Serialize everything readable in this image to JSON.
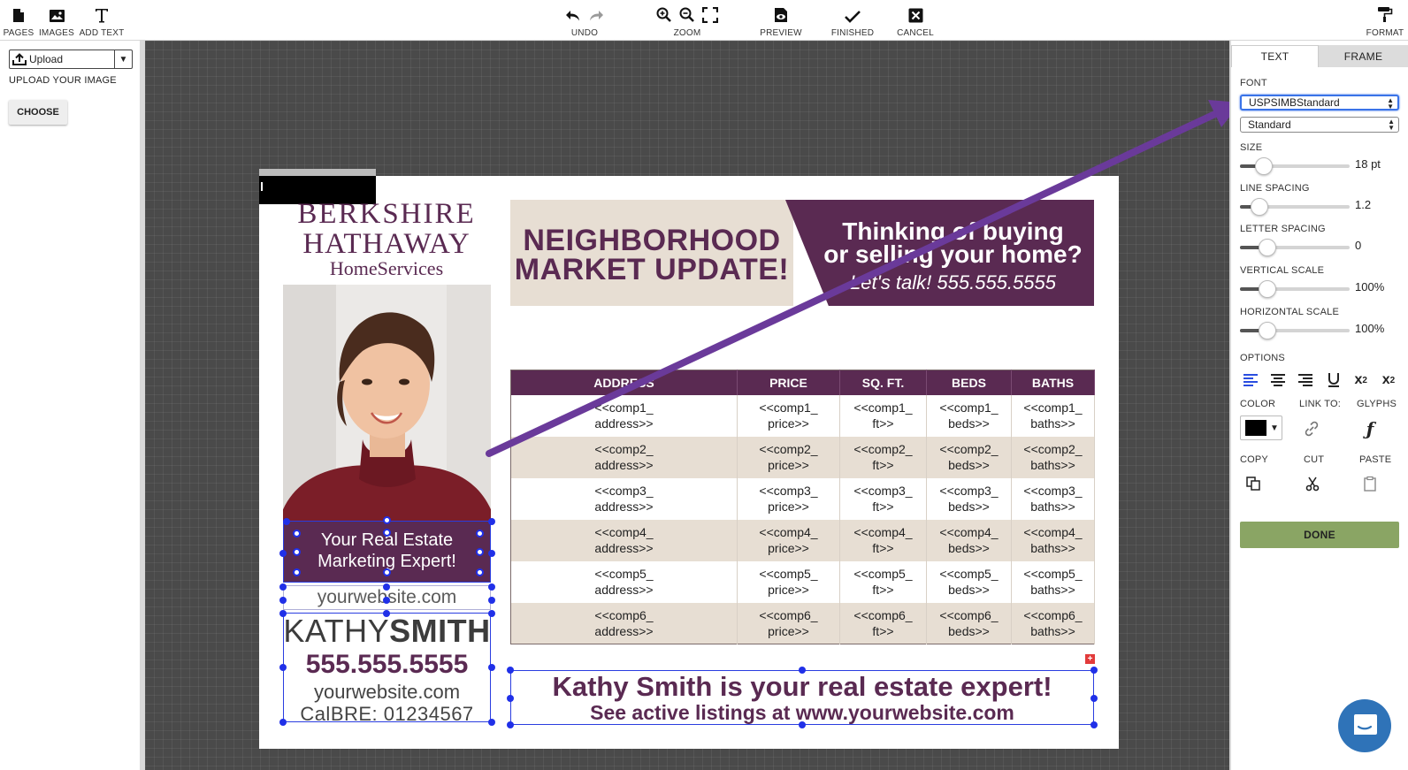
{
  "toolbar": {
    "pages": "PAGES",
    "images": "IMAGES",
    "add_text": "ADD TEXT",
    "undo": "UNDO",
    "zoom": "ZOOM",
    "preview": "PREVIEW",
    "finished": "FINISHED",
    "cancel": "CANCEL",
    "format": "FORMAT"
  },
  "left_panel": {
    "upload_select": "Upload",
    "upload_caption": "UPLOAD YOUR IMAGE",
    "choose_button": "CHOOSE"
  },
  "document": {
    "logo": [
      "BERKSHIRE",
      "HATHAWAY",
      "HomeServices"
    ],
    "banner_title_1": "NEIGHBORHOOD",
    "banner_title_2": "MARKET UPDATE!",
    "banner_right_1": "Thinking of buying",
    "banner_right_2": "or selling your home?",
    "banner_right_3": "Let's talk! 555.555.5555",
    "tagline_1": "Your Real Estate",
    "tagline_2": "Marketing Expert!",
    "website_small": "yourwebsite.com",
    "name_first": "KATHY",
    "name_last": "SMITH",
    "phone": "555.555.5555",
    "website": "yourwebsite.com",
    "calbre": "CalBRE: 01234567",
    "cta_1": "Kathy Smith is your real estate expert!",
    "cta_2": "See active listings at www.yourwebsite.com",
    "table": {
      "headers": [
        "ADDRESS",
        "PRICE",
        "SQ. FT.",
        "BEDS",
        "BATHS"
      ],
      "rows": [
        [
          [
            "<<comp1_",
            "address>>"
          ],
          [
            "<<comp1_",
            "price>>"
          ],
          [
            "<<comp1_",
            "ft>>"
          ],
          [
            "<<comp1_",
            "beds>>"
          ],
          [
            "<<comp1_",
            "baths>>"
          ]
        ],
        [
          [
            "<<comp2_",
            "address>>"
          ],
          [
            "<<comp2_",
            "price>>"
          ],
          [
            "<<comp2_",
            "ft>>"
          ],
          [
            "<<comp2_",
            "beds>>"
          ],
          [
            "<<comp2_",
            "baths>>"
          ]
        ],
        [
          [
            "<<comp3_",
            "address>>"
          ],
          [
            "<<comp3_",
            "price>>"
          ],
          [
            "<<comp3_",
            "ft>>"
          ],
          [
            "<<comp3_",
            "beds>>"
          ],
          [
            "<<comp3_",
            "baths>>"
          ]
        ],
        [
          [
            "<<comp4_",
            "address>>"
          ],
          [
            "<<comp4_",
            "price>>"
          ],
          [
            "<<comp4_",
            "ft>>"
          ],
          [
            "<<comp4_",
            "beds>>"
          ],
          [
            "<<comp4_",
            "baths>>"
          ]
        ],
        [
          [
            "<<comp5_",
            "address>>"
          ],
          [
            "<<comp5_",
            "price>>"
          ],
          [
            "<<comp5_",
            "ft>>"
          ],
          [
            "<<comp5_",
            "beds>>"
          ],
          [
            "<<comp5_",
            "baths>>"
          ]
        ],
        [
          [
            "<<comp6_",
            "address>>"
          ],
          [
            "<<comp6_",
            "price>>"
          ],
          [
            "<<comp6_",
            "ft>>"
          ],
          [
            "<<comp6_",
            "beds>>"
          ],
          [
            "<<comp6_",
            "baths>>"
          ]
        ]
      ]
    }
  },
  "right_panel": {
    "tab_text": "TEXT",
    "tab_frame": "FRAME",
    "font_label": "FONT",
    "font_family": "USPSIMBStandard",
    "font_style": "Standard",
    "size_label": "SIZE",
    "size_value": "18 pt",
    "size_level": 0.22,
    "line_spacing_label": "LINE SPACING",
    "line_spacing_value": "1.2",
    "line_spacing_level": 0.18,
    "letter_spacing_label": "LETTER SPACING",
    "letter_spacing_value": "0",
    "letter_spacing_level": 0.25,
    "vertical_scale_label": "VERTICAL SCALE",
    "vertical_scale_value": "100%",
    "vertical_scale_level": 0.25,
    "horizontal_scale_label": "HORIZONTAL SCALE",
    "horizontal_scale_value": "100%",
    "horizontal_scale_level": 0.25,
    "options_label": "OPTIONS",
    "color_label": "COLOR",
    "link_label": "LINK TO:",
    "glyphs_label": "GLYPHS",
    "copy_label": "COPY",
    "cut_label": "CUT",
    "paste_label": "PASTE",
    "done_button": "DONE",
    "color_value": "#000000"
  },
  "colors": {
    "brand_purple": "#5a2a52",
    "banner_beige": "#e7ded3",
    "annotation_arrow": "#6a3a9a",
    "done_green": "#8aa564",
    "selection_blue": "#2030e8"
  }
}
